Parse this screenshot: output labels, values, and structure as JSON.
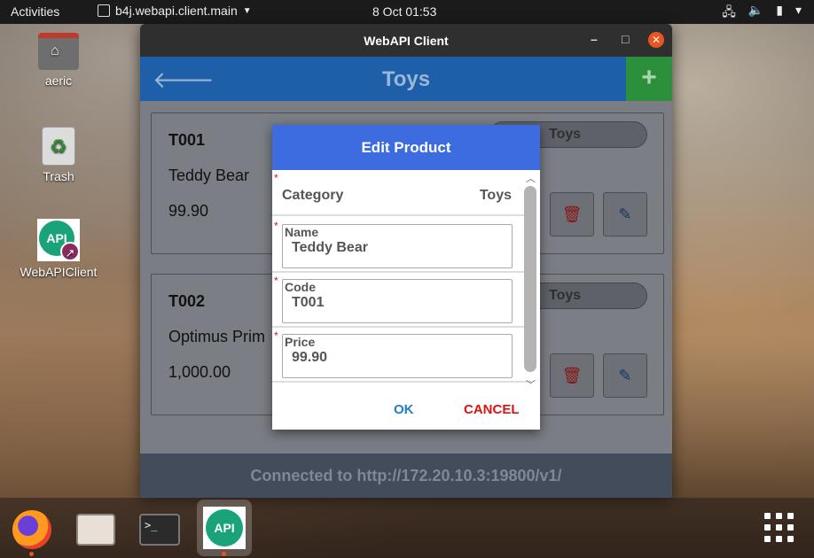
{
  "topbar": {
    "activities": "Activities",
    "app_menu": "b4j.webapi.client.main",
    "clock": "8 Oct  01:53",
    "tray_icons": [
      "network-icon",
      "volume-icon",
      "battery-icon",
      "power-menu-icon"
    ]
  },
  "desktop": {
    "icons": [
      {
        "label": "aeric",
        "icon": "home-folder-icon"
      },
      {
        "label": "Trash",
        "icon": "trash-icon"
      },
      {
        "label": "WebAPIClient",
        "icon": "api-app-icon"
      }
    ]
  },
  "window": {
    "title": "WebAPI Client",
    "controls": {
      "minimize": "–",
      "maximize": "□",
      "close": "✕"
    }
  },
  "app": {
    "header": {
      "back": "🡐",
      "title": "Toys",
      "add": "+"
    },
    "products": [
      {
        "code": "T001",
        "name": "Teddy Bear",
        "price": "99.90",
        "category": "Toys"
      },
      {
        "code": "T002",
        "name": "Optimus Prim",
        "price": "1,000.00",
        "category": "Toys"
      }
    ],
    "footer": "Connected to http://172.20.10.3:19800/v1/"
  },
  "dialog": {
    "title": "Edit Product",
    "category_label": "Category",
    "category_value": "Toys",
    "name_label": "Name",
    "name_value": "Teddy Bear",
    "code_label": "Code",
    "code_value": "T001",
    "price_label": "Price",
    "price_value": "99.90",
    "required_marker": "*",
    "ok": "OK",
    "cancel": "CANCEL"
  },
  "dock": {
    "apps": [
      "firefox-icon",
      "files-icon",
      "terminal-icon",
      "webapi-client-icon",
      "show-apps-icon"
    ],
    "terminal_prompt": ">_",
    "api_label": "API"
  },
  "colors": {
    "header_blue": "#1d5fa8",
    "add_green": "#2b8f3b",
    "dialog_blue": "#3d6ce0",
    "ok_blue": "#1f7fc0",
    "cancel_red": "#dd1111",
    "ubuntu_orange": "#e95420"
  }
}
